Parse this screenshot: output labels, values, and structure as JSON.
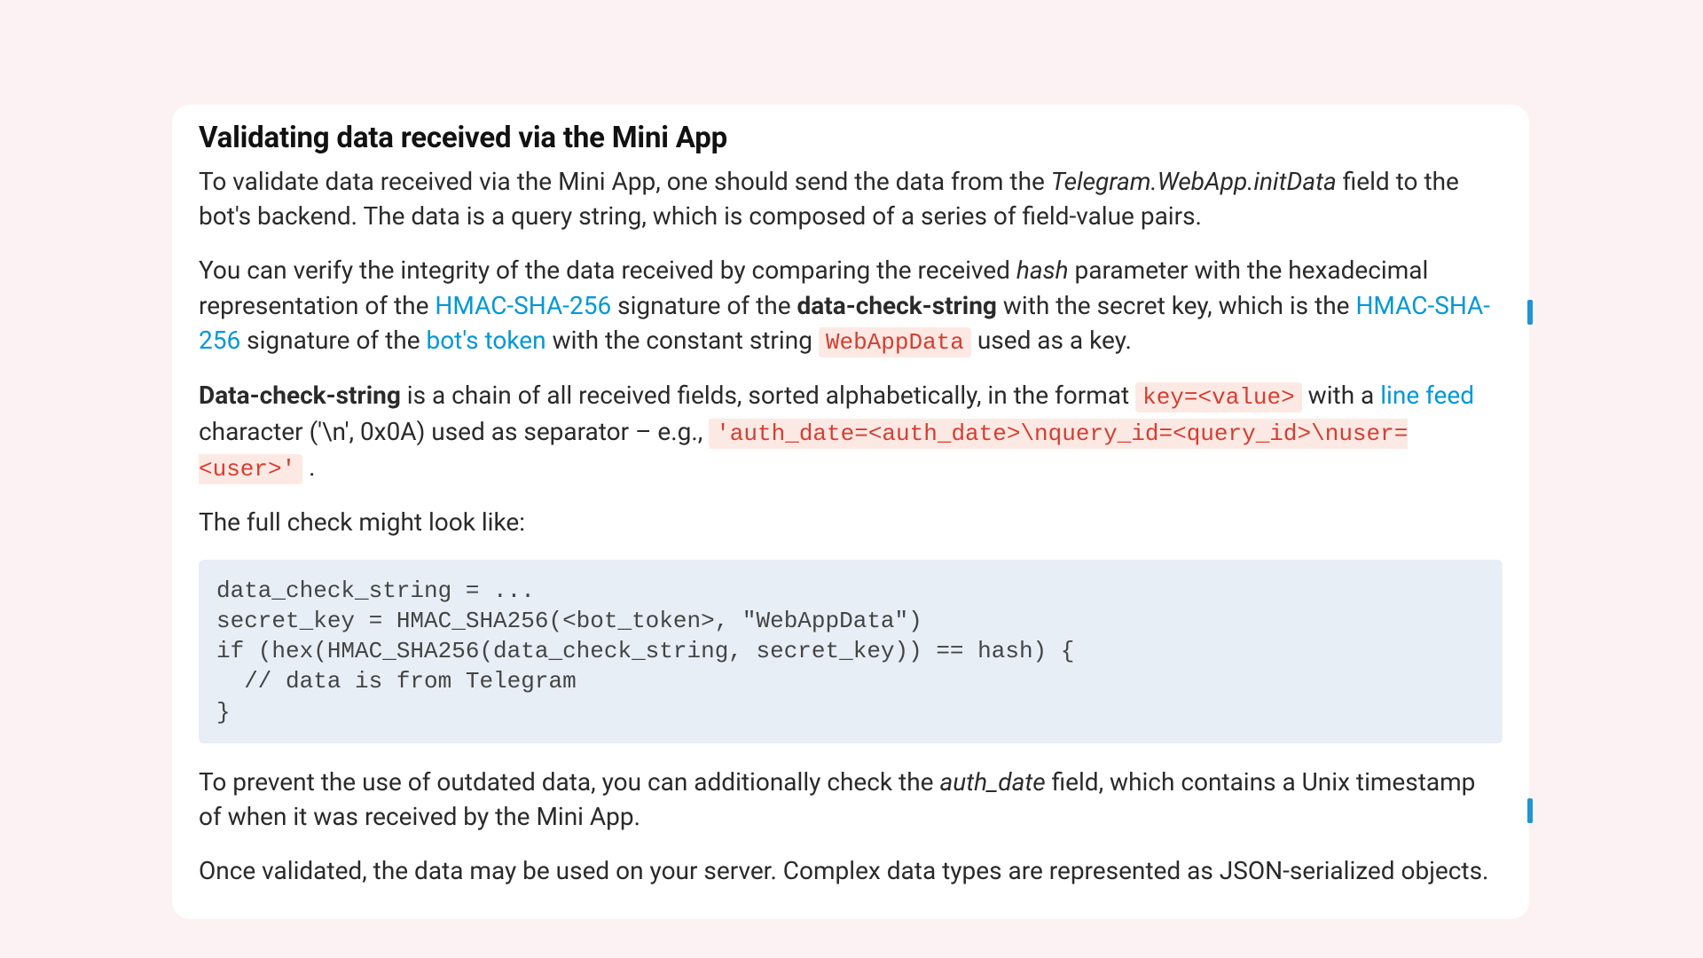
{
  "title": "Validating data received via the Mini App",
  "p1": {
    "a": "To validate data received via the Mini App, one should send the data from the ",
    "i": "Telegram.WebApp.initData",
    "b": " field to the bot's backend. The data is a query string, which is composed of a series of field-value pairs."
  },
  "p2": {
    "a": "You can verify the integrity of the data received by comparing the received ",
    "i": "hash",
    "b": " parameter with the hexadecimal representation of the ",
    "link1": "HMAC-SHA-256",
    "c": " signature of the ",
    "bold": "data-check-string",
    "d": " with the secret key, which is the ",
    "link2": "HMAC-SHA-256",
    "e": " signature of the ",
    "link3": "bot's token",
    "f": " with the constant string ",
    "code": "WebAppData",
    "g": " used as a key."
  },
  "p3": {
    "bold": "Data-check-string",
    "a": " is a chain of all received fields, sorted alphabetically, in the format ",
    "code1": "key=<value>",
    "b": " with a ",
    "link": "line feed",
    "c": " character ('\\n', 0x0A) used as separator – e.g., ",
    "code2": "'auth_date=<auth_date>\\nquery_id=<query_id>\\nuser=<user>'",
    "d": " ."
  },
  "p4": "The full check might look like:",
  "codeblock": "data_check_string = ...\nsecret_key = HMAC_SHA256(<bot_token>, \"WebAppData\")\nif (hex(HMAC_SHA256(data_check_string, secret_key)) == hash) {\n  // data is from Telegram\n}",
  "p5": {
    "a": "To prevent the use of outdated data, you can additionally check the ",
    "i": "auth_date",
    "b": " field, which contains a Unix timestamp of when it was received by the Mini App."
  },
  "p6": "Once validated, the data may be used on your server. Complex data types are represented as JSON-serialized objects."
}
